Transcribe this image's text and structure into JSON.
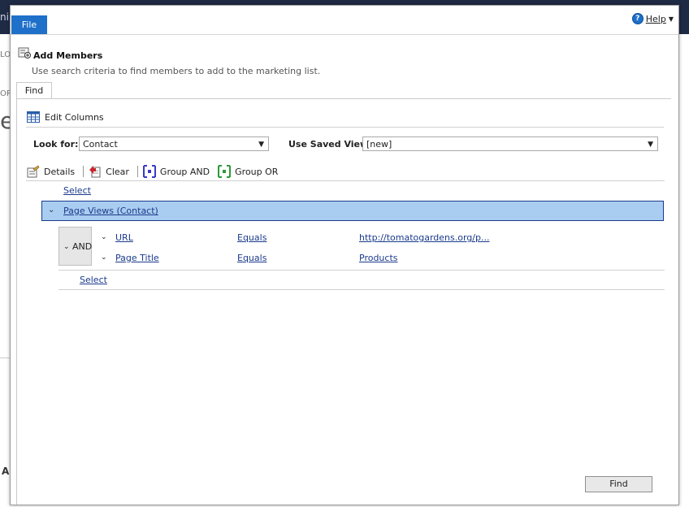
{
  "dialog": {
    "file_tab": "File",
    "help_label": "Help",
    "title": "Add Members",
    "subtitle": "Use search criteria to find members to add to the marketing list."
  },
  "tabs": {
    "find": "Find"
  },
  "toolbar": {
    "edit_columns": "Edit Columns",
    "details": "Details",
    "clear": "Clear",
    "group_and": "Group AND",
    "group_or": "Group OR"
  },
  "lookfor": {
    "label": "Look for:",
    "value": "Contact"
  },
  "saved_view": {
    "label": "Use Saved View:",
    "value": "[new]"
  },
  "query": {
    "select_link": "Select",
    "group": "Page Views (Contact)",
    "and_label": "AND",
    "criteria": [
      {
        "field": "URL",
        "operator": "Equals",
        "value": "http://tomatogardens.org/p..."
      },
      {
        "field": "Page Title",
        "operator": "Equals",
        "value": "Products"
      }
    ],
    "inner_select_link": "Select"
  },
  "footer": {
    "find_button": "Find"
  },
  "background": {
    "frag1": "ni",
    "frag2": "LO",
    "frag3": "ORI",
    "frag4": "e",
    "frag5": "A"
  },
  "colors": {
    "accent": "#1e70c9",
    "selected_row": "#a9cdf0",
    "link": "#1a3a8c"
  }
}
